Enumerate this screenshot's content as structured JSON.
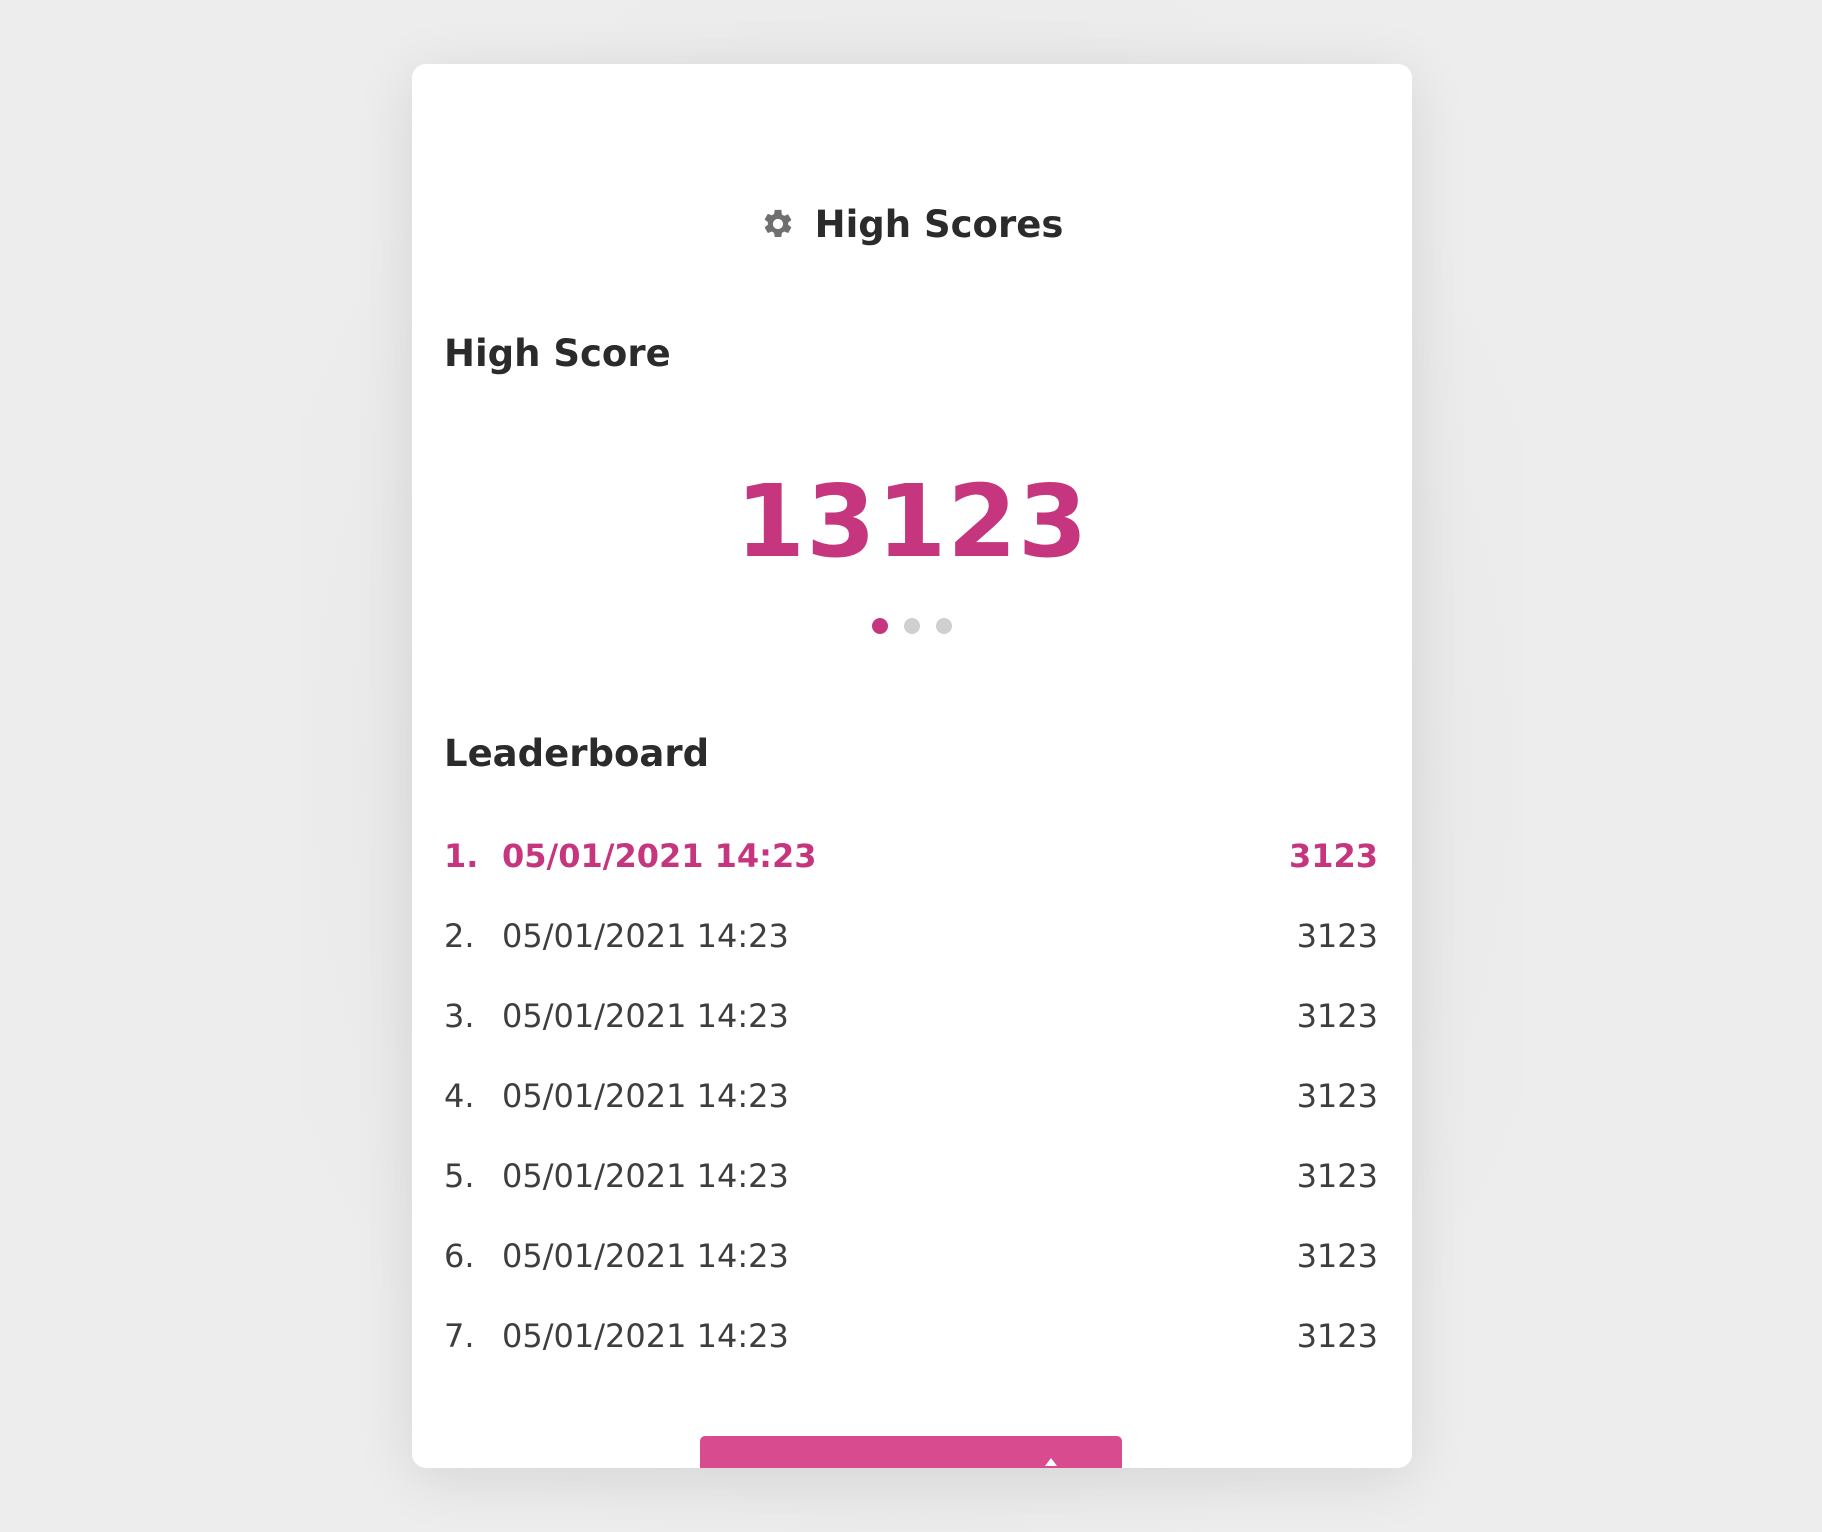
{
  "header": {
    "title": "High Scores",
    "icon": "gear-icon"
  },
  "high_score": {
    "section_title": "High Score",
    "value": "13123",
    "pager": {
      "count": 3,
      "active_index": 0
    }
  },
  "leaderboard": {
    "section_title": "Leaderboard",
    "rows": [
      {
        "rank": "1.",
        "date": "05/01/2021 14:23",
        "score": "3123",
        "highlight": true
      },
      {
        "rank": "2.",
        "date": "05/01/2021 14:23",
        "score": "3123"
      },
      {
        "rank": "3.",
        "date": "05/01/2021 14:23",
        "score": "3123"
      },
      {
        "rank": "4.",
        "date": "05/01/2021 14:23",
        "score": "3123"
      },
      {
        "rank": "5.",
        "date": "05/01/2021 14:23",
        "score": "3123"
      },
      {
        "rank": "6.",
        "date": "05/01/2021 14:23",
        "score": "3123"
      },
      {
        "rank": "7.",
        "date": "05/01/2021 14:23",
        "score": "3123"
      }
    ]
  },
  "colors": {
    "accent": "#c5367f",
    "button": "#d94b8f",
    "text": "#2b2b2b",
    "muted_dot": "#cfcfcf",
    "background": "#ededed"
  }
}
